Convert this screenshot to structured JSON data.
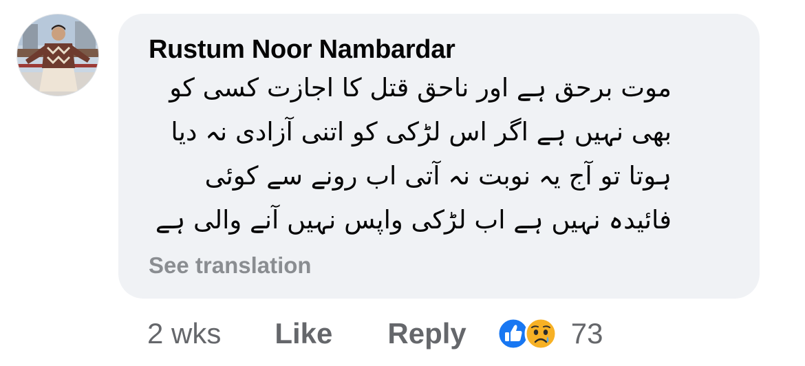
{
  "comment": {
    "author": "Rustum Noor Nambardar",
    "body_lines": [
      "موت برحق ہے اور ناحق قتل کا اجازت کسی کو",
      "بھی نہیں ہے اگر اس لڑکی کو اتنی آزادی نہ دیا",
      "ہوتا تو آج یہ نوبت نہ آتی اب رونے سے کوئی",
      "فائیدہ نہیں ہے اب لڑکی واپس نہیں آنے والی ہے"
    ],
    "see_translation": "See translation"
  },
  "actions": {
    "time": "2 wks",
    "like_label": "Like",
    "reply_label": "Reply"
  },
  "reactions": {
    "types": [
      "like",
      "sad"
    ],
    "count": "73",
    "colors": {
      "like": "#1877f2",
      "sad": "#f7b125"
    }
  },
  "colors": {
    "bubble_bg": "#f0f2f5",
    "text_primary": "#050505",
    "text_secondary": "#65676b",
    "translation_link": "#8a8d91"
  }
}
